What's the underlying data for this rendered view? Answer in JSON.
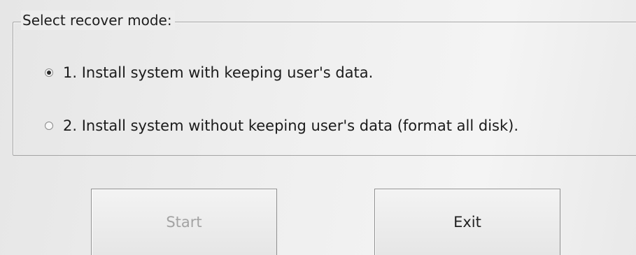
{
  "recover_group": {
    "legend": "Select recover mode:",
    "options": [
      {
        "label": "1. Install system with keeping user's data.",
        "selected": true
      },
      {
        "label": "2. Install system without keeping user's data (format all disk).",
        "selected": false
      }
    ]
  },
  "buttons": {
    "start": {
      "label": "Start",
      "enabled": false
    },
    "exit": {
      "label": "Exit",
      "enabled": true
    }
  }
}
